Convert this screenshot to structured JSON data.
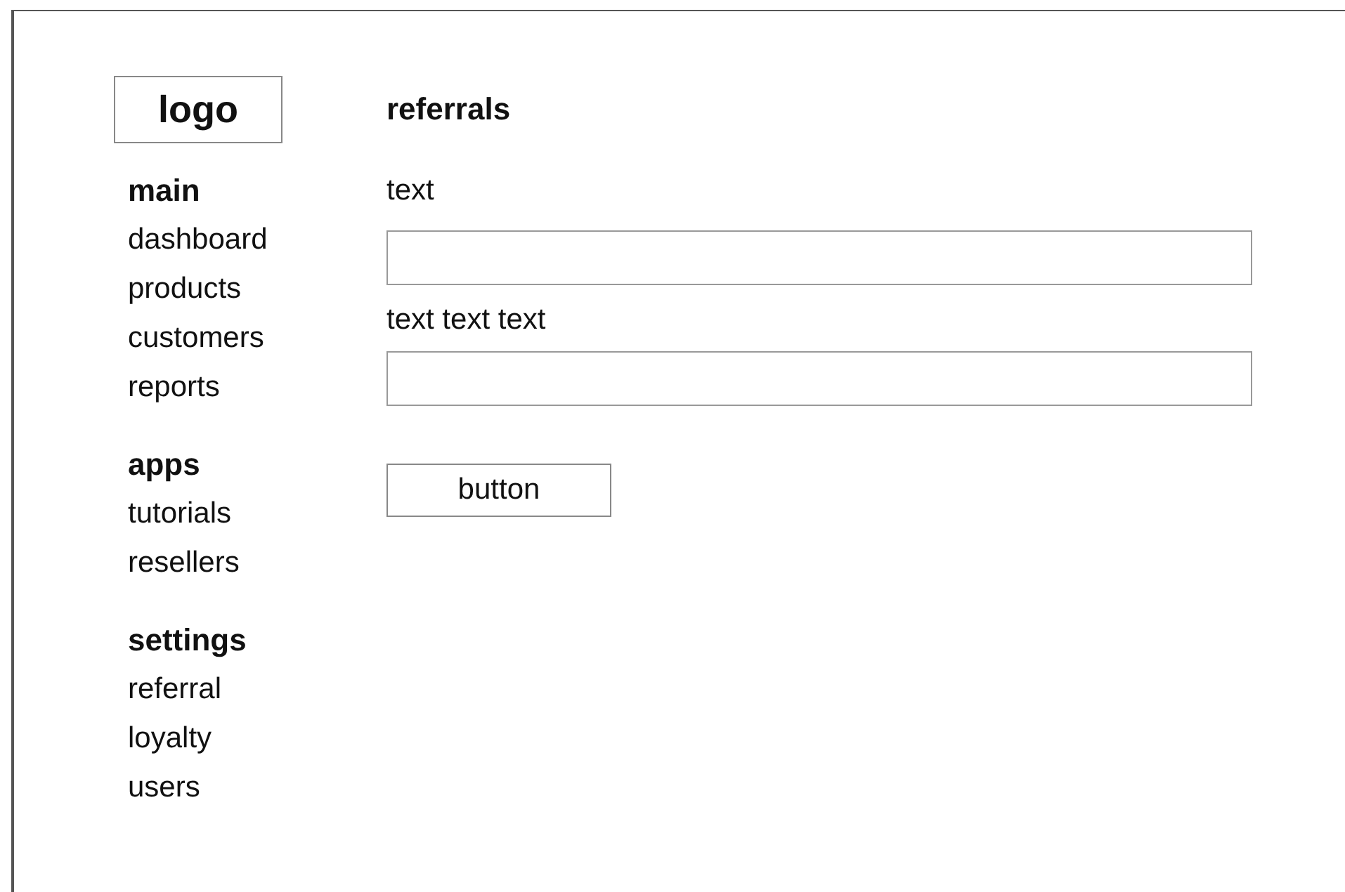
{
  "logo": "logo",
  "nav": [
    {
      "heading": "main",
      "items": [
        "dashboard",
        "products",
        "customers",
        "reports"
      ]
    },
    {
      "heading": "apps",
      "items": [
        "tutorials",
        "resellers"
      ]
    },
    {
      "heading": "settings",
      "items": [
        "referral",
        "loyalty",
        "users"
      ]
    }
  ],
  "page": {
    "title": "referrals",
    "fields": [
      {
        "label": "text"
      },
      {
        "label": "text text text"
      }
    ],
    "button": "button"
  }
}
